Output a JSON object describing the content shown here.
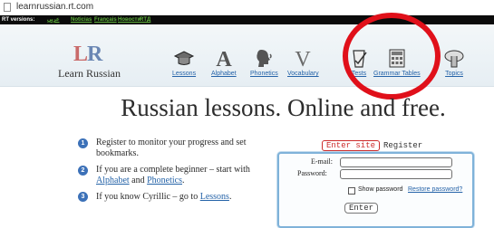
{
  "browser": {
    "url": "learnrussian.rt.com"
  },
  "rt_bar": {
    "label": "RT versions:",
    "versions": [
      "عربي",
      "Noticias",
      "Français",
      "Новости",
      "RTД"
    ]
  },
  "logo": {
    "mark_l": "L",
    "mark_r": "R",
    "name": "Learn Russian"
  },
  "nav": [
    {
      "label": "Lessons",
      "icon": "lessons-icon"
    },
    {
      "label": "Alphabet",
      "icon": "alphabet-icon"
    },
    {
      "label": "Phonetics",
      "icon": "phonetics-icon"
    },
    {
      "label": "Vocabulary",
      "icon": "vocabulary-icon"
    },
    {
      "label": "Tests",
      "icon": "tests-icon"
    },
    {
      "label": "Grammar Tables",
      "icon": "grammar-tables-icon"
    },
    {
      "label": "Topics",
      "icon": "topics-icon"
    }
  ],
  "title": "Russian lessons. Online and free.",
  "info": [
    {
      "num": "1",
      "line1": "Register to monitor your progress and set",
      "line2": "bookmarks."
    },
    {
      "num": "2",
      "line1": "If you are a complete beginner – start with",
      "link_a": "Alphabet",
      "and": " and ",
      "link_b": "Phonetics",
      "period": "."
    },
    {
      "num": "3",
      "text": "If you know Cyrillic – go to ",
      "link": "Lessons",
      "period": "."
    }
  ],
  "login": {
    "tab_enter": "Enter site",
    "tab_register": "Register",
    "email_label": "E-mail:",
    "password_label": "Password:",
    "show_password": "Show password",
    "restore_password": "Restore password?",
    "enter_button": "Enter"
  },
  "colors": {
    "annotation_circle": "#e0101a",
    "link": "#2563a8",
    "accent_blue": "#3c71b8"
  }
}
